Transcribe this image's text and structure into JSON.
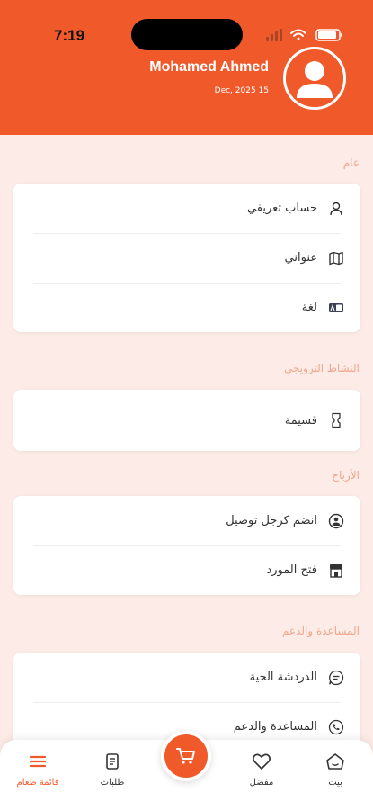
{
  "status_bar": {
    "time": "7:19"
  },
  "header": {
    "name": "Mohamed Ahmed",
    "date": "Dec, 2025 15"
  },
  "sections": {
    "general": {
      "title": "عام",
      "items": [
        {
          "label": "حساب تعريفي",
          "icon": "person-icon"
        },
        {
          "label": "عنواني",
          "icon": "map-icon"
        },
        {
          "label": "لغة",
          "icon": "language-icon"
        }
      ]
    },
    "promo": {
      "title": "النشاط الترويجي",
      "items": [
        {
          "label": "قسيمة",
          "icon": "coupon-icon"
        }
      ]
    },
    "earnings": {
      "title": "الأرباح",
      "items": [
        {
          "label": "انضم كرجل توصيل",
          "icon": "delivery-man-icon"
        },
        {
          "label": "فتح المورد",
          "icon": "store-icon"
        }
      ]
    },
    "support": {
      "title": "المساعدة والدعم",
      "items": [
        {
          "label": "الدردشة الحية",
          "icon": "chat-icon"
        },
        {
          "label": "المساعدة والدعم",
          "icon": "phone-icon"
        }
      ]
    }
  },
  "bottom_nav": {
    "menu": "قائمة طعام",
    "orders": "طلبات",
    "favorites": "مفضل",
    "home": "بيت"
  },
  "colors": {
    "primary": "#f05a2b",
    "background": "#fcebe6",
    "section_label": "#f0a68c"
  }
}
